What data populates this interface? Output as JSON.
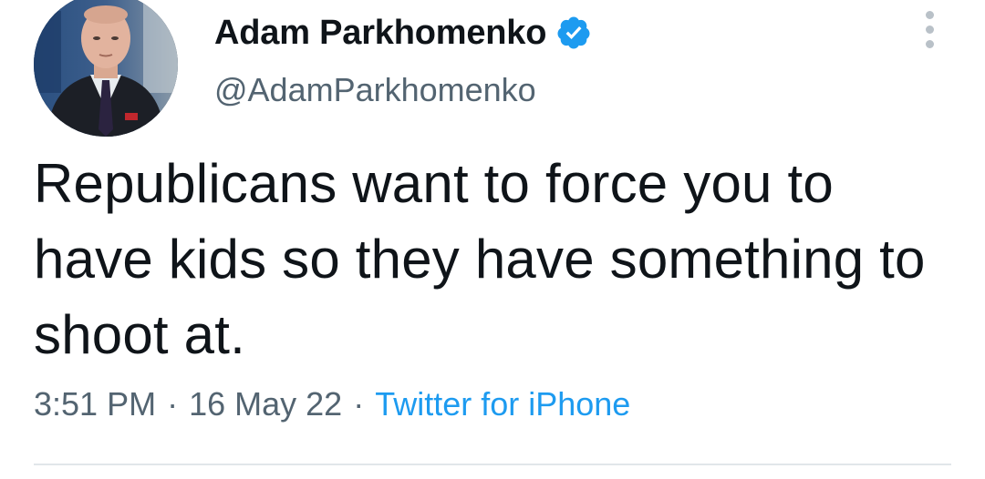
{
  "tweet": {
    "author": {
      "display_name": "Adam Parkhomenko",
      "handle": "@AdamParkhomenko",
      "verified": true,
      "avatar_icon": "profile-photo"
    },
    "text": "Republicans want to force you to have kids so they have something to shoot at.",
    "time": "3:51 PM",
    "date": "16 May 22",
    "separator": "·",
    "source": "Twitter for iPhone"
  },
  "colors": {
    "text_primary": "#0f1419",
    "text_secondary": "#536471",
    "accent": "#1d9bf0",
    "divider": "#e1e6ea"
  },
  "icons": {
    "verified": "verified-badge-icon",
    "more": "more-options-icon"
  }
}
